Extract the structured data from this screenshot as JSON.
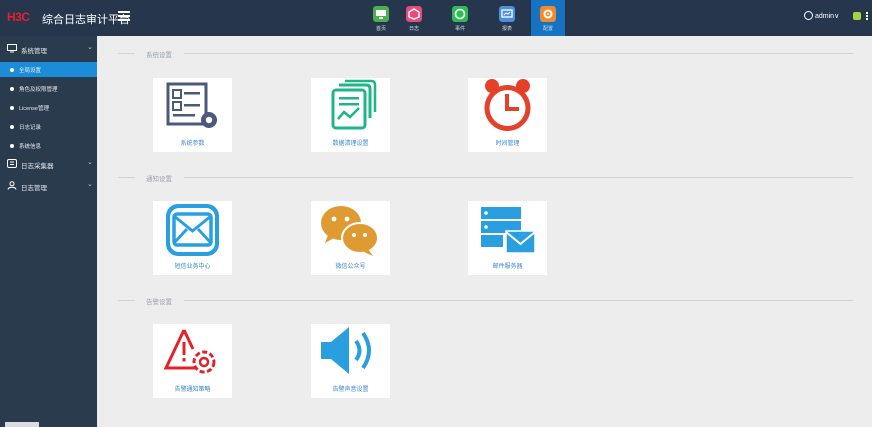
{
  "header": {
    "logo": "H3C",
    "app_title": "综合日志审计平台",
    "nav": [
      {
        "label": "首页",
        "icon": "monitor-icon",
        "color": "#4caf50"
      },
      {
        "label": "日志",
        "icon": "cube-icon",
        "color": "#e84a7b"
      },
      {
        "label": "事件",
        "icon": "event-icon",
        "color": "#2ebd53"
      },
      {
        "label": "报表",
        "icon": "report-icon",
        "color": "#4a8fe0"
      },
      {
        "label": "配置",
        "icon": "gear-icon",
        "color": "#f08a2c",
        "active": true
      }
    ],
    "user": "admin∨"
  },
  "sidebar": {
    "groups": [
      {
        "label": "系统管理",
        "icon": "monitor-icon"
      },
      {
        "label": "日志采集器",
        "icon": "collector-icon"
      },
      {
        "label": "日志管理",
        "icon": "user-icon"
      }
    ],
    "sub_items": [
      {
        "label": "全局设置",
        "active": true
      },
      {
        "label": "角色及权限管理"
      },
      {
        "label": "License管理"
      },
      {
        "label": "日志记录"
      },
      {
        "label": "系统信息"
      }
    ]
  },
  "main": {
    "sections": [
      {
        "title": "系统设置"
      },
      {
        "title": "通知设置"
      },
      {
        "title": "告警设置"
      }
    ],
    "cards": [
      {
        "label": "系统参数",
        "icon": "system-params-icon"
      },
      {
        "label": "数据清理设置",
        "icon": "data-cleanup-icon"
      },
      {
        "label": "时间管理",
        "icon": "alarm-clock-icon"
      },
      {
        "label": "短信业务中心",
        "icon": "envelope-icon"
      },
      {
        "label": "微信公众号",
        "icon": "wechat-icon"
      },
      {
        "label": "邮件服务器",
        "icon": "mail-server-icon"
      },
      {
        "label": "告警通知策略",
        "icon": "alert-gear-icon"
      },
      {
        "label": "告警声音设置",
        "icon": "speaker-icon"
      }
    ]
  }
}
